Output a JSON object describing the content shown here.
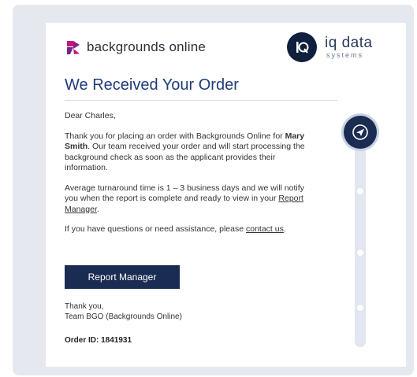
{
  "brand": {
    "name": "backgrounds online",
    "partner_main": "iq data",
    "partner_sub": "systems"
  },
  "email": {
    "title": "We Received Your Order",
    "greeting": "Dear Charles,",
    "p1_prefix": "Thank you for placing an order with Backgrounds Online for ",
    "applicant": "Mary Smith",
    "p1_suffix": ". Our team received your order and will start processing the background check as soon as the applicant provides their information.",
    "p2_prefix": "Average turnaround time is 1 – 3 business days and we will notify you when the report is complete and ready to view in your ",
    "p2_link": "Report Manager",
    "p2_suffix": ".",
    "p3_prefix": "If you have questions or need assistance, please ",
    "p3_link": "contact us",
    "p3_suffix": ".",
    "button_label": "Report Manager",
    "signoff_line1": "Thank you,",
    "signoff_line2": "Team BGO (Backgrounds Online)",
    "order_id": "Order ID: 1841931"
  },
  "icons": {
    "brand_logo": "backgrounds-online-logo",
    "partner_logo": "iq-data-logo",
    "status": "paper-plane-icon"
  },
  "colors": {
    "navy": "#1a2c52",
    "title_blue": "#1f3c7a",
    "logo_magenta": "#c2187a"
  }
}
